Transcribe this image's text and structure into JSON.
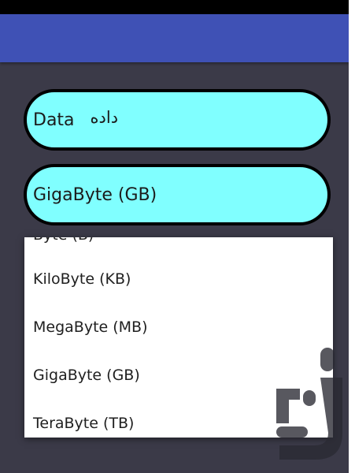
{
  "category_field": {
    "label": "Data",
    "sub_label": "داده"
  },
  "unit_spinner": {
    "selected": "GigaByte (GB)"
  },
  "unit_dropdown": {
    "partial_top_item": "Byte (B)",
    "items": [
      "KiloByte (KB)",
      "MegaByte (MB)",
      "GigaByte (GB)",
      "TeraByte (TB)"
    ]
  },
  "colors": {
    "status_bar": "#000000",
    "app_bar": "#3f51b5",
    "background": "#3b3a48",
    "field_fill": "#80ffff",
    "field_border": "#000000",
    "dropdown_bg": "#ffffff"
  }
}
